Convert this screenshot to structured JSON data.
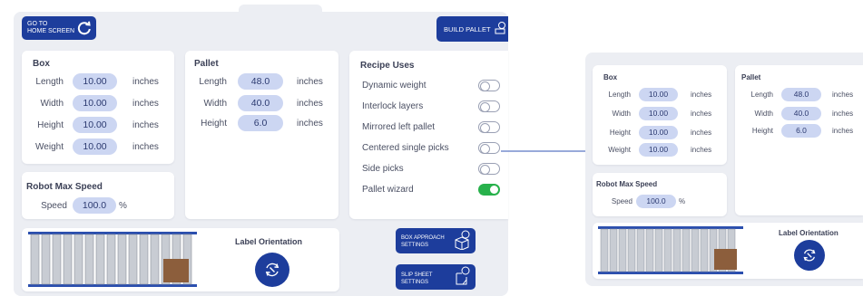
{
  "colors": {
    "accent": "#1d3d9c",
    "pill": "#ccd6f2",
    "toggle_on": "#27b14b",
    "panel": "#eceef3",
    "connector": "#5b78c4"
  },
  "header": {
    "home_button": {
      "line1": "GO TO",
      "line2": "HOME SCREEN",
      "icon": "refresh-icon"
    },
    "build_button": {
      "label": "BUILD PALLET",
      "icon": "pallet-build-icon"
    }
  },
  "box": {
    "title": "Box",
    "rows": [
      {
        "label": "Length",
        "value": "10.00",
        "unit": "inches"
      },
      {
        "label": "Width",
        "value": "10.00",
        "unit": "inches"
      },
      {
        "label": "Height",
        "value": "10.00",
        "unit": "inches"
      },
      {
        "label": "Weight",
        "value": "10.00",
        "unit": "inches"
      }
    ]
  },
  "pallet": {
    "title": "Pallet",
    "rows": [
      {
        "label": "Length",
        "value": "48.0",
        "unit": "inches"
      },
      {
        "label": "Width",
        "value": "40.0",
        "unit": "inches"
      },
      {
        "label": "Height",
        "value": "6.0",
        "unit": "inches"
      }
    ]
  },
  "recipe": {
    "title": "Recipe Uses",
    "items": [
      {
        "label": "Dynamic weight",
        "on": false
      },
      {
        "label": "Interlock layers",
        "on": false
      },
      {
        "label": "Mirrored left pallet",
        "on": false
      },
      {
        "label": "Centered single picks",
        "on": false
      },
      {
        "label": "Side picks",
        "on": false
      },
      {
        "label": "Pallet wizard",
        "on": true
      }
    ]
  },
  "robot": {
    "title": "Robot Max Speed",
    "speed_label": "Speed",
    "speed_value": "100.0",
    "speed_unit": "%"
  },
  "label_orientation": {
    "title": "Label Orientation",
    "icon": "rotate-icon"
  },
  "box_approach": {
    "line1": "BOX APPROACH",
    "line2": "SETTINGS",
    "icon": "box-approach-icon"
  },
  "slip_sheet": {
    "line1": "SLIP SHEET",
    "line2": "SETTINGS",
    "icon": "slip-sheet-icon"
  },
  "zoom": {
    "box": {
      "title": "Box",
      "rows": [
        {
          "label": "Length",
          "value": "10.00",
          "unit": "inches"
        },
        {
          "label": "Width",
          "value": "10.00",
          "unit": "inches"
        },
        {
          "label": "Height",
          "value": "10.00",
          "unit": "inches"
        },
        {
          "label": "Weight",
          "value": "10.00",
          "unit": "inches"
        }
      ]
    },
    "pallet": {
      "title": "Pallet",
      "rows": [
        {
          "label": "Length",
          "value": "48.0",
          "unit": "inches"
        },
        {
          "label": "Width",
          "value": "40.0",
          "unit": "inches"
        },
        {
          "label": "Height",
          "value": "6.0",
          "unit": "inches"
        }
      ]
    },
    "robot": {
      "title": "Robot Max Speed",
      "speed_label": "Speed",
      "speed_value": "100.0",
      "speed_unit": "%"
    },
    "label_orientation": {
      "title": "Label Orientation"
    }
  }
}
